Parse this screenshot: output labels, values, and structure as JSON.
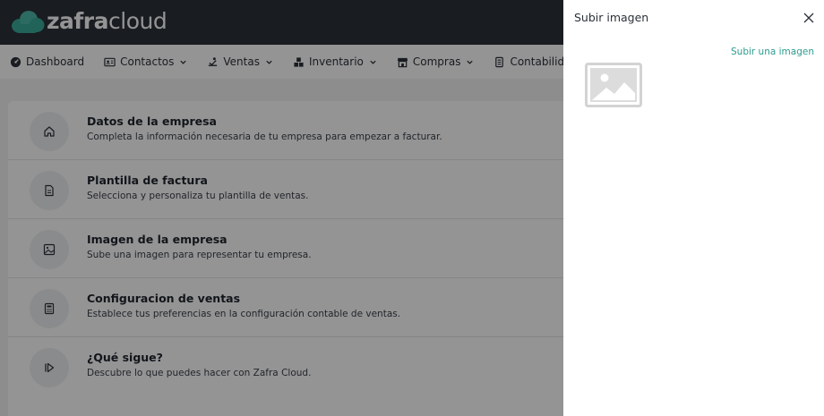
{
  "header": {
    "logo_bold": "zafra",
    "logo_light": "cloud"
  },
  "nav": {
    "items": [
      {
        "label": "Dashboard",
        "icon": "dashboard-icon",
        "has_menu": false
      },
      {
        "label": "Contactos",
        "icon": "contacts-icon",
        "has_menu": true
      },
      {
        "label": "Ventas",
        "icon": "sales-icon",
        "has_menu": true
      },
      {
        "label": "Inventario",
        "icon": "inventory-icon",
        "has_menu": true
      },
      {
        "label": "Compras",
        "icon": "store-icon",
        "has_menu": true
      },
      {
        "label": "Contabilidad",
        "icon": "accounting-icon",
        "has_menu": false
      }
    ]
  },
  "steps": [
    {
      "title": "Datos de la empresa",
      "desc": "Completa la información necesaria de tu empresa para empezar a facturar.",
      "icon": "home-icon"
    },
    {
      "title": "Plantilla de factura",
      "desc": "Selecciona y personaliza tu plantilla de ventas.",
      "icon": "document-icon"
    },
    {
      "title": "Imagen de la empresa",
      "desc": "Sube una imagen para representar tu empresa.",
      "icon": "image-icon"
    },
    {
      "title": "Configuracion de ventas",
      "desc": "Establece tus preferencias en la configuración contable de ventas.",
      "icon": "calculator-icon"
    },
    {
      "title": "¿Qué sigue?",
      "desc": "Descubre lo que puedes hacer con Zafra Cloud.",
      "icon": "play-icon"
    }
  ],
  "drawer": {
    "title": "Subir imagen",
    "upload_link": "Subir una imagen"
  },
  "colors": {
    "header_bg": "#2b3139",
    "accent": "#2c9c8e",
    "cloud": "#3aa99a"
  }
}
